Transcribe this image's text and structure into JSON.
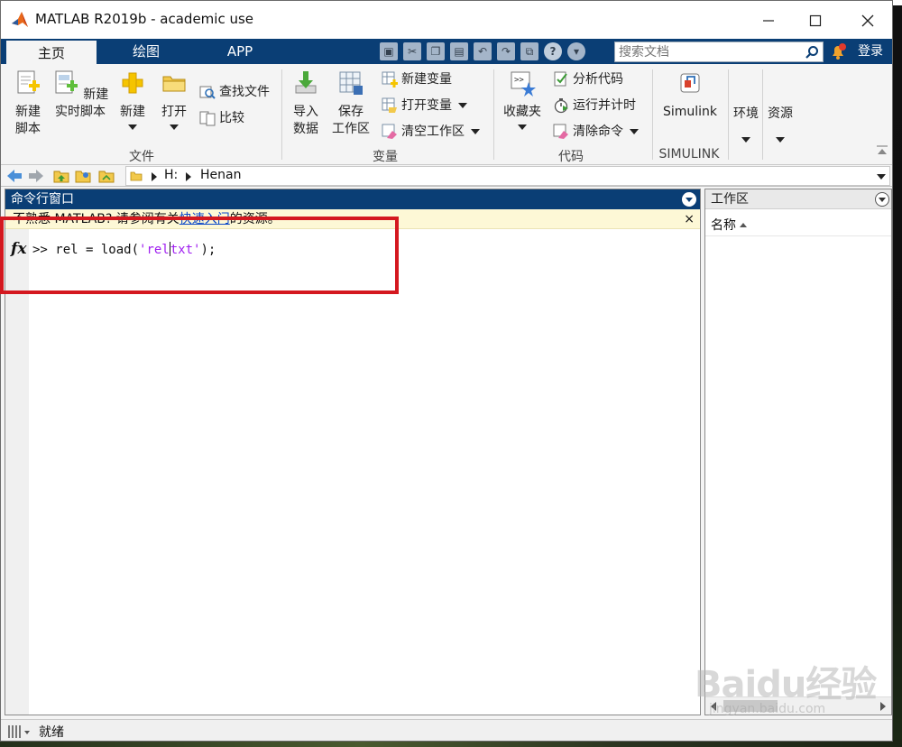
{
  "window": {
    "title": "MATLAB R2019b - academic use"
  },
  "tabs": [
    {
      "label": "主页",
      "active": true
    },
    {
      "label": "绘图",
      "active": false
    },
    {
      "label": "APP",
      "active": false
    }
  ],
  "search": {
    "placeholder": "搜索文档"
  },
  "user": {
    "login_label": "登录"
  },
  "ribbon": {
    "file": {
      "group_label": "文件",
      "new_script": [
        "新建",
        "脚本"
      ],
      "new_live_script": [
        "新建",
        "实时脚本"
      ],
      "new": "新建",
      "open": "打开",
      "find_files": "查找文件",
      "compare": "比较"
    },
    "variable": {
      "group_label": "变量",
      "import_data": [
        "导入",
        "数据"
      ],
      "save_workspace": [
        "保存",
        "工作区"
      ],
      "new_variable": "新建变量",
      "open_variable": "打开变量",
      "clear_workspace": "清空工作区"
    },
    "code": {
      "group_label": "代码",
      "favorites": "收藏夹",
      "analyze_code": "分析代码",
      "run_and_time": "运行并计时",
      "clear_commands": "清除命令"
    },
    "simulink": {
      "group_label": "SIMULINK",
      "simulink": "Simulink"
    },
    "environment": "环境",
    "resources": "资源"
  },
  "address": {
    "drive": "H:",
    "folder": "Henan"
  },
  "command_window": {
    "title": "命令行窗口",
    "notice_prefix": "不熟悉 MATLAB? 请参阅有关",
    "notice_link": "快速入门",
    "notice_suffix": "的资源。",
    "notice_close": "×",
    "prompt": ">> rel = load(",
    "string_part1": "'rel",
    "string_part2": "txt'",
    "suffix": ");"
  },
  "workspace": {
    "title": "工作区",
    "column_name": "名称"
  },
  "status": {
    "text": "就绪"
  },
  "watermark": {
    "brand": "Baidu经验",
    "url": "jingyan.baidu.com"
  },
  "colors": {
    "ribbon_blue": "#0a3e75",
    "highlight_red": "#d4181f",
    "notice_bg": "#fdf8d6",
    "string_purple": "#a020f0"
  }
}
